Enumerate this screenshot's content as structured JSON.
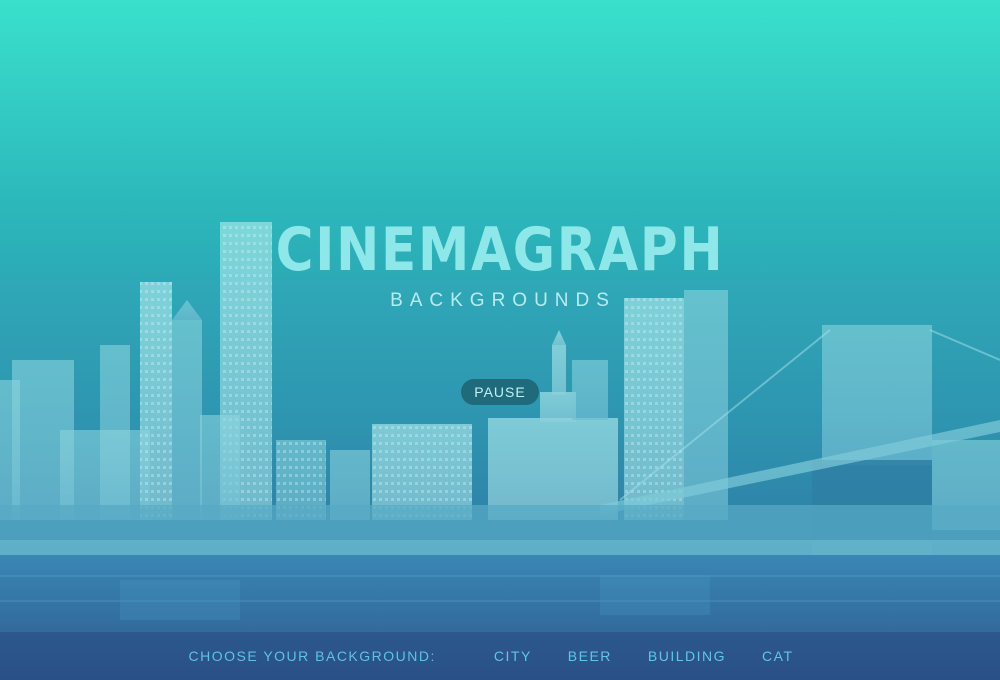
{
  "hero": {
    "title": "CINEMAGRAPH",
    "subtitle": "BACKGROUNDS"
  },
  "controls": {
    "pause_label": "PAUSE"
  },
  "background_picker": {
    "label": "CHOOSE YOUR BACKGROUND:",
    "options": [
      "CITY",
      "BEER",
      "BUILDING",
      "CAT"
    ]
  },
  "colors": {
    "sky_top": "#3ae0cc",
    "water": "#2c5f92",
    "title": "#8ee8ea",
    "link": "#5fc6e6"
  }
}
